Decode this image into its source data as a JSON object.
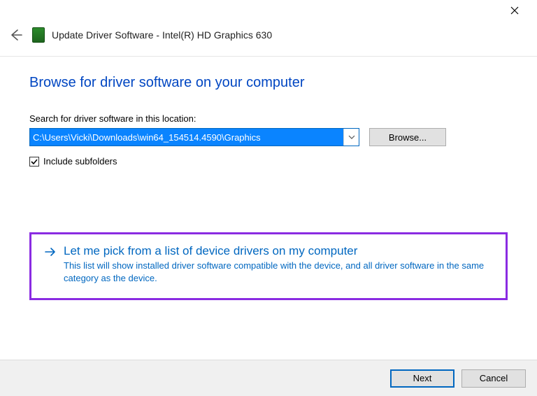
{
  "window": {
    "title": "Update Driver Software - Intel(R) HD Graphics 630"
  },
  "page": {
    "heading": "Browse for driver software on your computer",
    "search_label": "Search for driver software in this location:",
    "path_value": "C:\\Users\\Vicki\\Downloads\\win64_154514.4590\\Graphics",
    "browse_label": "Browse...",
    "include_subfolders_label": "Include subfolders",
    "include_subfolders_checked": true
  },
  "option": {
    "title": "Let me pick from a list of device drivers on my computer",
    "description": "This list will show installed driver software compatible with the device, and all driver software in the same category as the device."
  },
  "footer": {
    "next_label": "Next",
    "cancel_label": "Cancel"
  }
}
